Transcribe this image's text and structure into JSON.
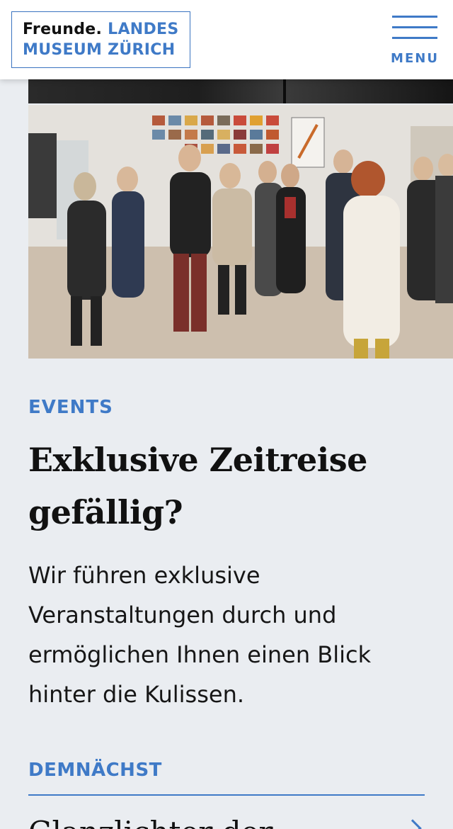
{
  "header": {
    "logo": {
      "line1_dark": "Freunde.",
      "line1_blue": "LANDES",
      "line2_blue": "MUSEUM ZÜRICH"
    },
    "menu_label": "MENU"
  },
  "teaser": {
    "category": "EVENTS",
    "title_line1": "Exklusive Zeitreise",
    "title_line2": "gefällig?",
    "body_line1": "Wir führen exklusive",
    "body_line2": "Veranstaltungen durch und",
    "body_line3": "ermöglichen Ihnen einen Blick",
    "body_line4": "hinter die Kulissen."
  },
  "upcoming": {
    "label": "DEMNÄCHST",
    "first_item_partial": "Glanzlichter der"
  },
  "colors": {
    "accent": "#3f7ac7",
    "background": "#eaedf1",
    "header_bg": "#ffffff"
  },
  "icons": {
    "menu": "hamburger-icon",
    "next": "chevron-right-icon"
  }
}
